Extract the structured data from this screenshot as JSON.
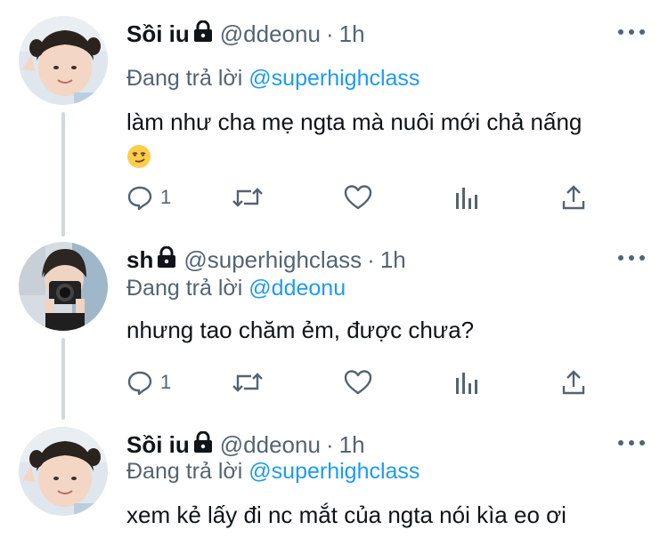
{
  "colors": {
    "text": "#0f1419",
    "muted": "#536471",
    "link": "#1d9bf0",
    "thread_line": "#cfd9de"
  },
  "tweets": [
    {
      "name": "Sồi iu",
      "handle": "@ddeonu",
      "separator": "·",
      "time": "1h",
      "reply_prefix": "Đang trả lời",
      "reply_to": "@superhighclass",
      "text_line1": "làm như cha mẹ ngta mà nuôi mới chả nấng",
      "text_emoji": "smirking-face-emoji",
      "reply_count": "1",
      "avatar_icon": "child-portrait-avatar"
    },
    {
      "name": "sh",
      "handle": "@superhighclass",
      "separator": "·",
      "time": "1h",
      "reply_prefix": "Đang trả lời",
      "reply_to": "@ddeonu",
      "text_line1": "nhưng tao chăm ẻm, được chưa?",
      "reply_count": "1",
      "avatar_icon": "camera-portrait-avatar"
    },
    {
      "name": "Sồi iu",
      "handle": "@ddeonu",
      "separator": "·",
      "time": "1h",
      "reply_prefix": "Đang trả lời",
      "reply_to": "@superhighclass",
      "text_line1": "xem kẻ lấy đi nc mắt của ngta nói kìa eo ơi",
      "avatar_icon": "child-portrait-avatar"
    }
  ],
  "icons": {
    "more": "more-dots-icon",
    "lock": "lock-icon",
    "reply": "reply-icon",
    "retweet": "retweet-icon",
    "like": "heart-icon",
    "analytics": "analytics-icon",
    "share": "share-icon"
  }
}
